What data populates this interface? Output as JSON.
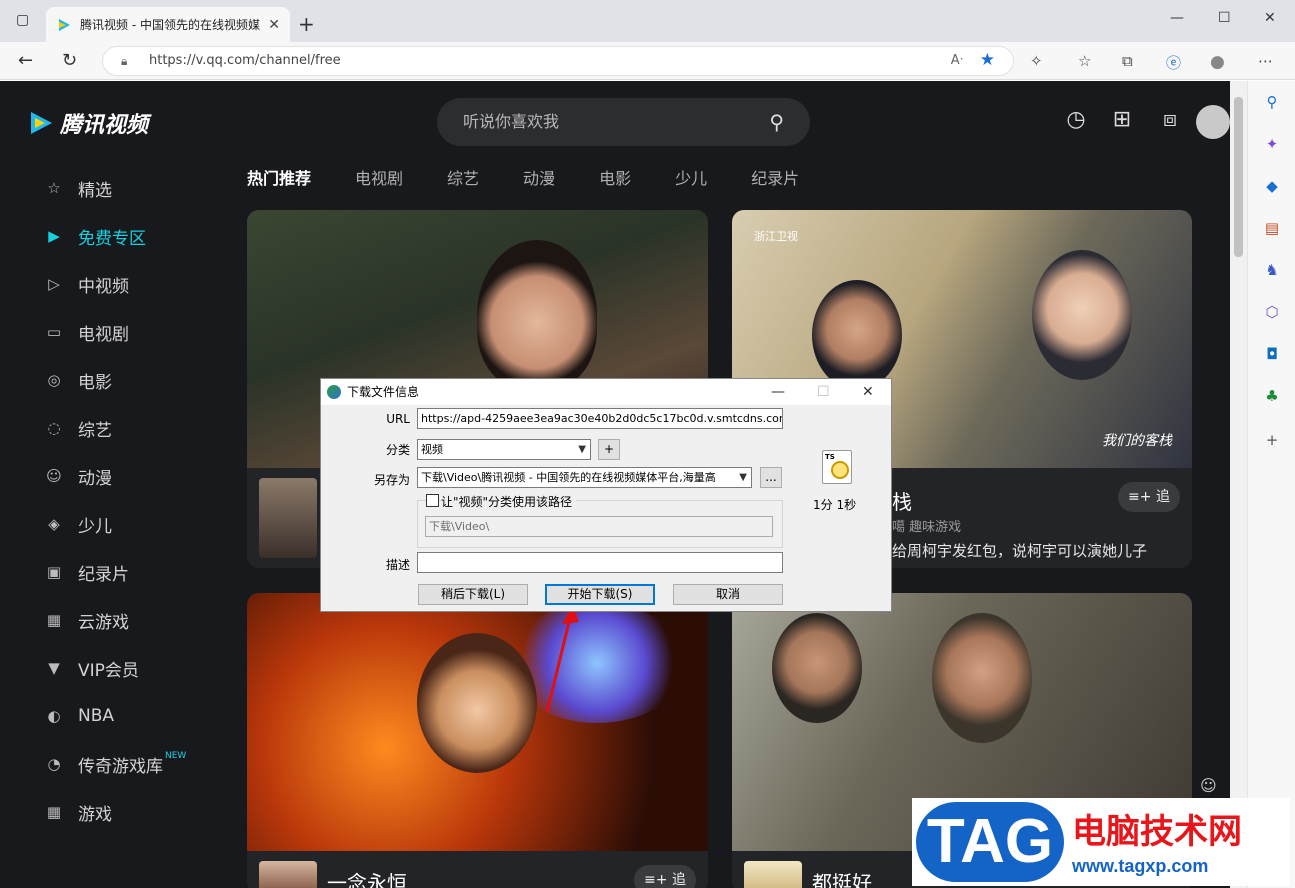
{
  "browser": {
    "tab_title": "腾讯视频 - 中国领先的在线视频媒",
    "url": "https://v.qq.com/channel/free"
  },
  "site": {
    "logo_text": "腾讯视频",
    "search_placeholder": "听说你喜欢我",
    "sidebar": [
      {
        "label": "精选",
        "icon": "star-icon",
        "glyph": "☆"
      },
      {
        "label": "免费专区",
        "icon": "play-icon",
        "glyph": "▶"
      },
      {
        "label": "中视频",
        "icon": "play-outline-icon",
        "glyph": "▷"
      },
      {
        "label": "电视剧",
        "icon": "tv-icon",
        "glyph": "▭"
      },
      {
        "label": "电影",
        "icon": "film-reel-icon",
        "glyph": "◎"
      },
      {
        "label": "综艺",
        "icon": "chat-icon",
        "glyph": "◌"
      },
      {
        "label": "动漫",
        "icon": "cartoon-face-icon",
        "glyph": "☺"
      },
      {
        "label": "少儿",
        "icon": "kids-icon",
        "glyph": "◈"
      },
      {
        "label": "纪录片",
        "icon": "camera-icon",
        "glyph": "▣"
      },
      {
        "label": "云游戏",
        "icon": "gamepad-icon",
        "glyph": "▦"
      },
      {
        "label": "VIP会员",
        "icon": "vip-icon",
        "glyph": "▼"
      },
      {
        "label": "NBA",
        "icon": "basketball-icon",
        "glyph": "◐"
      },
      {
        "label": "传奇游戏库",
        "icon": "legend-icon",
        "glyph": "◔"
      },
      {
        "label": "游戏",
        "icon": "game-icon",
        "glyph": "▦"
      }
    ],
    "sidebar_new_badge": "NEW",
    "categories": [
      "热门推荐",
      "电视剧",
      "综艺",
      "动漫",
      "电影",
      "少儿",
      "纪录片"
    ],
    "cards": [
      {
        "title": "",
        "sub": "",
        "desc": ""
      },
      {
        "title": "栈",
        "sub": "噶 趣味游戏",
        "desc": "给周柯宇发红包，说柯宇可以演她儿子",
        "follow": "追"
      },
      {
        "title": "一念永恒",
        "follow": "追"
      },
      {
        "title": "都挺好"
      }
    ],
    "card_logo": "浙江卫视",
    "card_overlay": "我们的客栈"
  },
  "dialog": {
    "title": "下载文件信息",
    "url_label": "URL",
    "url_value": "https://apd-4259aee3ea9ac30e40b2d0dc5c17bc0d.v.smtcdns.com/variety",
    "category_label": "分类",
    "category_value": "视频",
    "add_btn": "+",
    "saveas_label": "另存为",
    "saveas_value": "下载\\Video\\腾讯视频 - 中国领先的在线视频媒体平台,海量高",
    "browse_btn": "...",
    "checkbox_label": "让\"视频\"分类使用该路径",
    "path_value": "下载\\Video\\",
    "desc_label": "描述",
    "desc_value": "",
    "file_icon_text": "TS",
    "time_est": "1分 1秒",
    "later_btn": "稍后下载(L)",
    "start_btn": "开始下载(S)",
    "cancel_btn": "取消"
  },
  "watermark": {
    "tag": "TAG",
    "title": "电脑技术网",
    "url": "www.tagxp.com"
  },
  "colors": {
    "accent": "#19d0e0",
    "page_bg": "#18191c",
    "arrow": "#e01010"
  }
}
